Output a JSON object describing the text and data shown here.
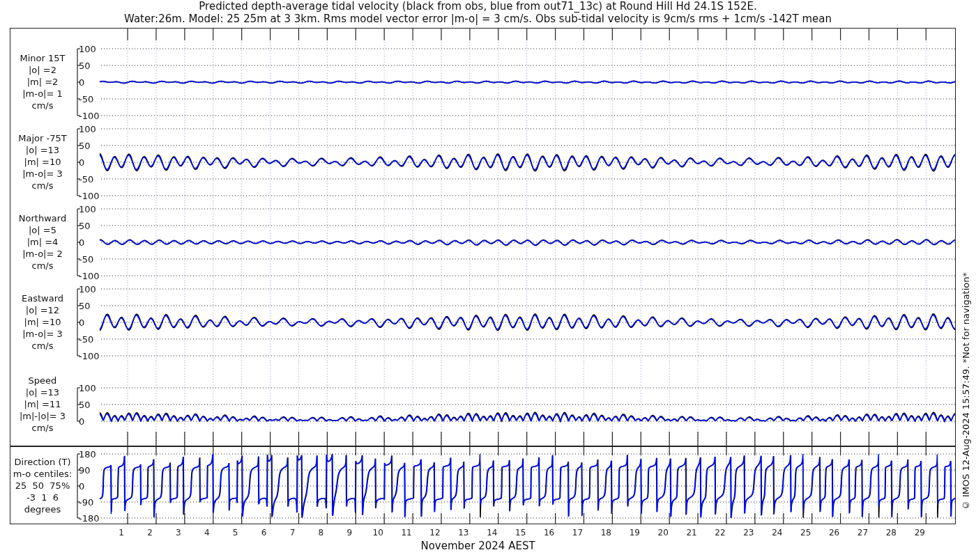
{
  "title_lines": [
    "Predicted depth-average tidal velocity (black from obs, blue from out71_13c) at Round Hill Hd 24.1S 152E.",
    "Water:26m. Model: 25 25m at 3 3km. Rms model vector error |m-o| = 3 cm/s. Obs sub-tidal velocity is 9cm/s rms + 1cm/s -142T mean"
  ],
  "panels": [
    {
      "kind": "minor",
      "label_lines": [
        "Minor 15T",
        "|o| =2",
        "|m| =2",
        "|m-o|= 1",
        "cm/s"
      ],
      "yticks": [
        "100",
        "50",
        "0",
        "-50",
        "-100"
      ]
    },
    {
      "kind": "major",
      "label_lines": [
        "Major -75T",
        "|o| =13",
        "|m| =10",
        "|m-o|= 3",
        "cm/s"
      ],
      "yticks": [
        "100",
        "50",
        "0",
        "-50",
        "-100"
      ]
    },
    {
      "kind": "north",
      "label_lines": [
        "Northward",
        "|o| =5",
        "|m| =4",
        "|m-o|= 2",
        "cm/s"
      ],
      "yticks": [
        "100",
        "50",
        "0",
        "-50",
        "-100"
      ]
    },
    {
      "kind": "east",
      "label_lines": [
        "Eastward",
        "|o| =12",
        "|m| =10",
        "|m-o|= 3",
        "cm/s"
      ],
      "yticks": [
        "100",
        "50",
        "0",
        "-50",
        "-100"
      ]
    },
    {
      "kind": "speed",
      "label_lines": [
        "Speed",
        "|o| =13",
        "|m| =11",
        "|m|-|o|= 3",
        "cm/s"
      ],
      "yticks": [
        "100",
        "50",
        "0"
      ]
    },
    {
      "kind": "direction",
      "label_lines": [
        "Direction (T)",
        "m-o centiles:",
        "25  50  75%",
        "-3  1  6",
        "degrees"
      ],
      "yticks": [
        "180",
        "90",
        "0",
        "-90",
        "-180"
      ]
    }
  ],
  "days": [
    "1",
    "2",
    "3",
    "4",
    "5",
    "6",
    "7",
    "8",
    "9",
    "10",
    "11",
    "12",
    "13",
    "14",
    "15",
    "16",
    "17",
    "18",
    "19",
    "20",
    "21",
    "22",
    "23",
    "24",
    "25",
    "26",
    "27",
    "28",
    "29"
  ],
  "xlabel": "November 2024 AEST",
  "credit": "© IMOS 12-Aug-2024 15:57:49. *Not for navigation*"
}
